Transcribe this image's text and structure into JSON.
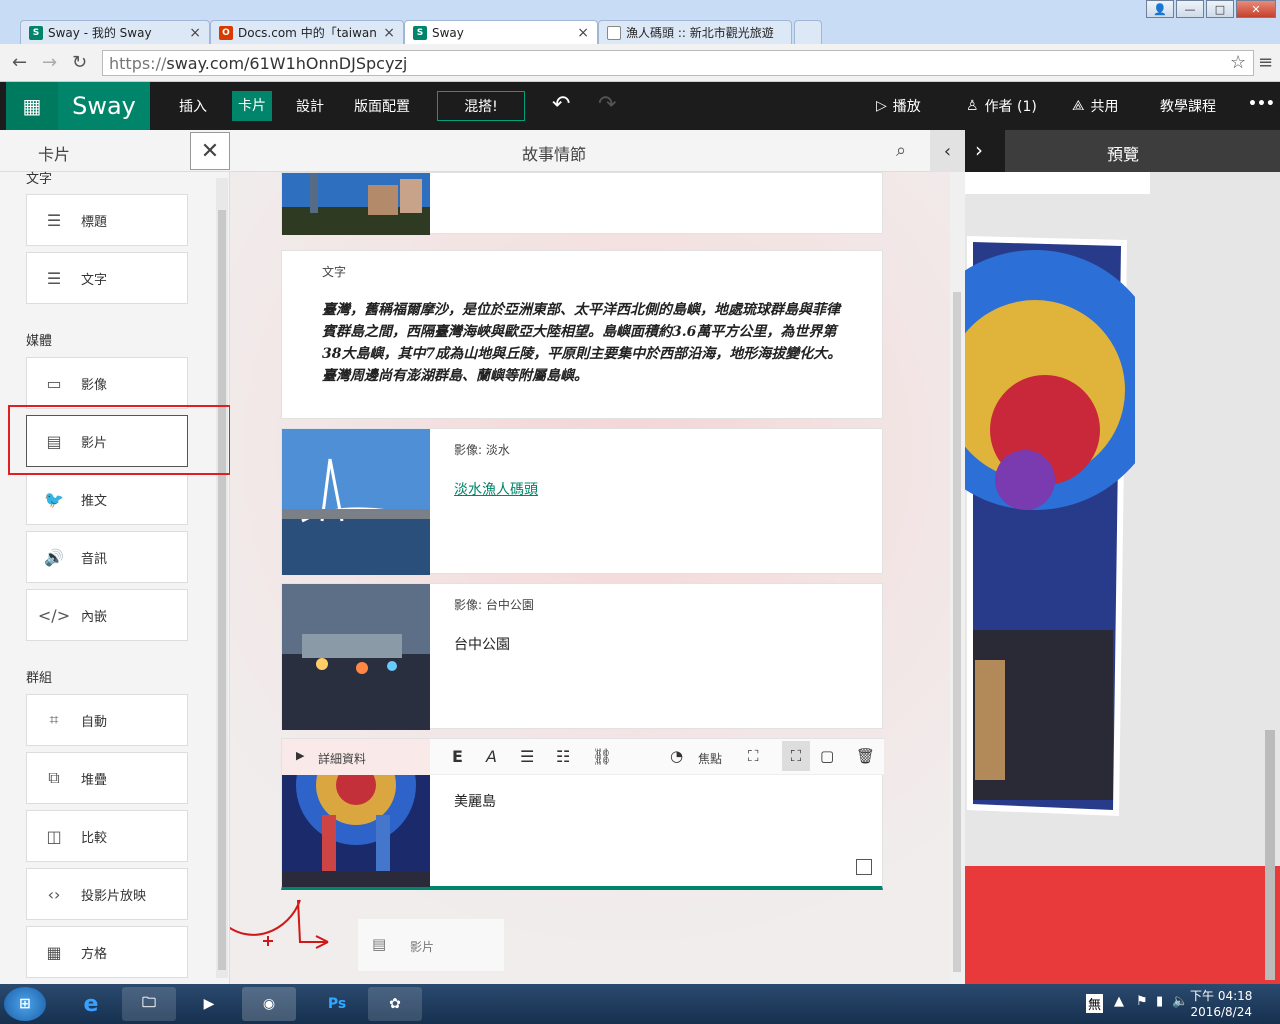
{
  "browser": {
    "tabs": [
      {
        "label": "Sway - 我的 Sway",
        "favicon": "sway",
        "color": "#00856a",
        "active": false
      },
      {
        "label": "Docs.com 中的「taiwan」",
        "favicon": "office",
        "color": "#d83b01",
        "active": false
      },
      {
        "label": "Sway",
        "favicon": "sway",
        "color": "#00856a",
        "active": true
      },
      {
        "label": "漁人碼頭 :: 新北市觀光旅遊",
        "favicon": "page",
        "color": "#888888",
        "active": false
      }
    ],
    "url_scheme": "https://",
    "url_rest": "sway.com/61W1hOnnDJSpcyzj"
  },
  "sway_bar": {
    "brand": "Sway",
    "menus": [
      "插入",
      "卡片",
      "設計",
      "版面配置"
    ],
    "selected_menu": "卡片",
    "remix": "混搭!",
    "play": "播放",
    "authors": "作者 (1)",
    "share": "共用",
    "tutorial": "教學課程",
    "more": "•••"
  },
  "left_panel": {
    "title": "卡片",
    "sections": {
      "text": "文字",
      "media": "媒體",
      "group": "群組"
    },
    "text_cards": [
      {
        "label": "標題",
        "icon": "heading-icon"
      },
      {
        "label": "文字",
        "icon": "text-icon"
      }
    ],
    "media_cards": [
      {
        "label": "影像",
        "icon": "image-icon"
      },
      {
        "label": "影片",
        "icon": "video-icon"
      },
      {
        "label": "推文",
        "icon": "twitter-icon"
      },
      {
        "label": "音訊",
        "icon": "audio-icon"
      },
      {
        "label": "內嵌",
        "icon": "embed-icon"
      }
    ],
    "group_cards": [
      {
        "label": "自動",
        "icon": "auto-icon"
      },
      {
        "label": "堆疊",
        "icon": "stack-icon"
      },
      {
        "label": "比較",
        "icon": "compare-icon"
      },
      {
        "label": "投影片放映",
        "icon": "slideshow-icon"
      },
      {
        "label": "方格",
        "icon": "grid-icon"
      }
    ]
  },
  "storyline": {
    "title": "故事情節",
    "text_card": {
      "label": "文字",
      "body": "臺灣，舊稱福爾摩沙，是位於亞洲東部、太平洋西北側的島嶼，地處琉球群島與菲律賓群島之間，西隔臺灣海峽與歐亞大陸相望。島嶼面積約3.6萬平方公里，為世界第38大島嶼，其中7成為山地與丘陵，平原則主要集中於西部沿海，地形海拔變化大。臺灣周邊尚有澎湖群島、蘭嶼等附屬島嶼。"
    },
    "image_card_1": {
      "label": "影像: 淡水",
      "link": "淡水漁人碼頭"
    },
    "image_card_2": {
      "label": "影像: 台中公園",
      "caption": "台中公園"
    },
    "image_card_3": {
      "details": "詳細資料",
      "focus": "焦點",
      "caption": "美麗島"
    },
    "drop_card": {
      "label": "影片"
    }
  },
  "preview": {
    "title": "預覽"
  },
  "taskbar": {
    "ime": "無",
    "time": "下午 04:18",
    "date": "2016/8/24"
  }
}
